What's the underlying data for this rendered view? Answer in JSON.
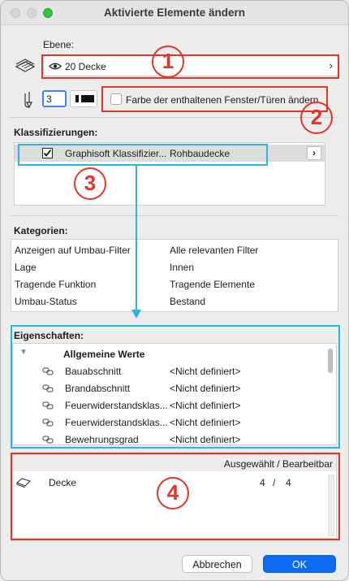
{
  "window": {
    "title": "Aktivierte Elemente ändern"
  },
  "ebene": {
    "label": "Ebene:",
    "value": "20 Decke"
  },
  "pen": {
    "value": "3"
  },
  "farbe_checkbox": {
    "label": "Farbe der enthaltenen Fenster/Türen ändern",
    "checked": false
  },
  "klassifizierungen": {
    "header": "Klassifizierungen:",
    "rows": [
      {
        "name": "Graphisoft Klassifizier...",
        "value": "Rohbaudecke",
        "checked": true
      }
    ]
  },
  "kategorien": {
    "header": "Kategorien:",
    "rows": [
      {
        "name": "Anzeigen auf Umbau-Filter",
        "value": "Alle relevanten Filter"
      },
      {
        "name": "Lage",
        "value": "Innen"
      },
      {
        "name": "Tragende Funktion",
        "value": "Tragende Elemente"
      },
      {
        "name": "Umbau-Status",
        "value": "Bestand"
      }
    ]
  },
  "eigenschaften": {
    "header": "Eigenschaften:",
    "group": "Allgemeine Werte",
    "rows": [
      {
        "name": "Bauabschnitt",
        "value": "<Nicht definiert>"
      },
      {
        "name": "Brandabschnitt",
        "value": "<Nicht definiert>"
      },
      {
        "name": "Feuerwiderstandsklas...",
        "value": "<Nicht definiert>"
      },
      {
        "name": "Feuerwiderstandsklas...",
        "value": "<Nicht definiert>"
      },
      {
        "name": "Bewehrungsgrad",
        "value": "<Nicht definiert>"
      }
    ]
  },
  "selection": {
    "header": "Ausgewählt / Bearbeitbar",
    "item": "Decke",
    "selected": "4",
    "separator": "/",
    "editable": "4"
  },
  "buttons": {
    "cancel": "Abbrechen",
    "ok": "OK"
  },
  "annotations": {
    "one": "1",
    "two": "2",
    "three": "3",
    "four": "4"
  },
  "colors": {
    "annotation_red": "#e53328",
    "annotation_blue": "#27b5e8",
    "accent": "#0b6cf2"
  }
}
